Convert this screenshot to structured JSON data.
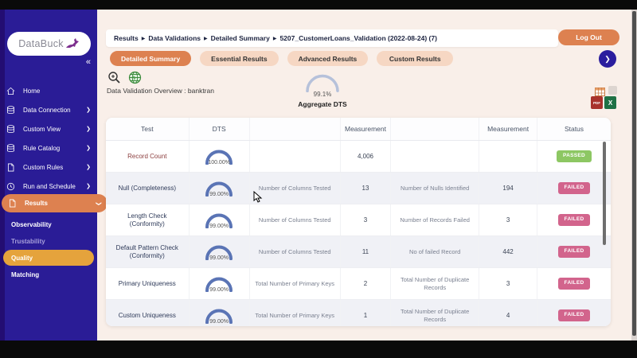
{
  "colors": {
    "accent_orange": "#dd8150",
    "sidebar_bg": "#2a1c96",
    "quality_pill_orange": "#e5a33c",
    "passed_green": "#8dc763",
    "failed_pink": "#d2648c",
    "gauge_blue": "#5a74b5",
    "content_bg": "#f9efe9"
  },
  "sidebar": {
    "logo_text": "DataBuck",
    "collapse_icon": "«",
    "items": [
      {
        "label": "Home",
        "icon": "home",
        "chevron": ""
      },
      {
        "label": "Data Connection",
        "icon": "database",
        "chevron": "❯"
      },
      {
        "label": "Custom View",
        "icon": "database",
        "chevron": "❯"
      },
      {
        "label": "Rule Catalog",
        "icon": "database",
        "chevron": "❯"
      },
      {
        "label": "Custom Rules",
        "icon": "file",
        "chevron": "❯"
      },
      {
        "label": "Run and Schedule",
        "icon": "clock",
        "chevron": "❯"
      }
    ],
    "results_item": {
      "label": "Results",
      "icon": "file",
      "chevron": "❯"
    },
    "sub_items": [
      {
        "label": "Observability",
        "state": "normal"
      },
      {
        "label": "Trustability",
        "state": "dimmed"
      },
      {
        "label": "Quality",
        "state": "active"
      },
      {
        "label": "Matching",
        "state": "normal"
      }
    ]
  },
  "header": {
    "breadcrumb": [
      "Results",
      "Data Validations",
      "Detailed Summary",
      "5207_CustomerLoans_Validation (2022-08-24) (7)"
    ],
    "separator": "▶",
    "logout_label": "Log Out",
    "next_icon": "❯"
  },
  "tabs": [
    {
      "label": "Detailed Summary",
      "active": true
    },
    {
      "label": "Essential Results",
      "active": false
    },
    {
      "label": "Advanced Results",
      "active": false
    },
    {
      "label": "Custom Results",
      "active": false
    }
  ],
  "toolbar": {
    "overview_label": "Data Validation Overview : banktran"
  },
  "aggregate_gauge": {
    "value": "99.1%",
    "label": "Aggregate DTS",
    "percent": 99.1
  },
  "export": {
    "pdf_label": "PDF",
    "excel_label": "X"
  },
  "table": {
    "headers": [
      "Test",
      "DTS",
      "",
      "Measurement",
      "",
      "Measurement",
      "Status"
    ],
    "rows": [
      {
        "test": "Record Count",
        "test_style": "maroon",
        "dts": "100.00%",
        "dts_pct": 100,
        "m1_label": "",
        "m1_value": "4,006",
        "m2_label": "",
        "m2_value": "",
        "status": "PASSED"
      },
      {
        "test": "Null (Completeness)",
        "test_style": "",
        "dts": "99.00%",
        "dts_pct": 99,
        "m1_label": "Number of Columns Tested",
        "m1_value": "13",
        "m2_label": "Number of Nulls Identified",
        "m2_value": "194",
        "status": "FAILED"
      },
      {
        "test": "Length Check (Conformity)",
        "test_style": "",
        "dts": "99.00%",
        "dts_pct": 99,
        "m1_label": "Number of Columns Tested",
        "m1_value": "3",
        "m2_label": "Number of Records Failed",
        "m2_value": "3",
        "status": "FAILED"
      },
      {
        "test": "Default Pattern Check (Conformity)",
        "test_style": "",
        "dts": "99.00%",
        "dts_pct": 99,
        "m1_label": "Number of Columns Tested",
        "m1_value": "11",
        "m2_label": "No of failed Record",
        "m2_value": "442",
        "status": "FAILED"
      },
      {
        "test": "Primary Uniqueness",
        "test_style": "",
        "dts": "99.00%",
        "dts_pct": 99,
        "m1_label": "Total Number of Primary Keys",
        "m1_value": "2",
        "m2_label": "Total Number of Duplicate Records",
        "m2_value": "3",
        "status": "FAILED"
      },
      {
        "test": "Custom Uniqueness",
        "test_style": "",
        "dts": "99.00%",
        "dts_pct": 99,
        "m1_label": "Total Number of Primary Keys",
        "m1_value": "1",
        "m2_label": "Total Number of Duplicate Records",
        "m2_value": "4",
        "status": "FAILED"
      }
    ]
  }
}
